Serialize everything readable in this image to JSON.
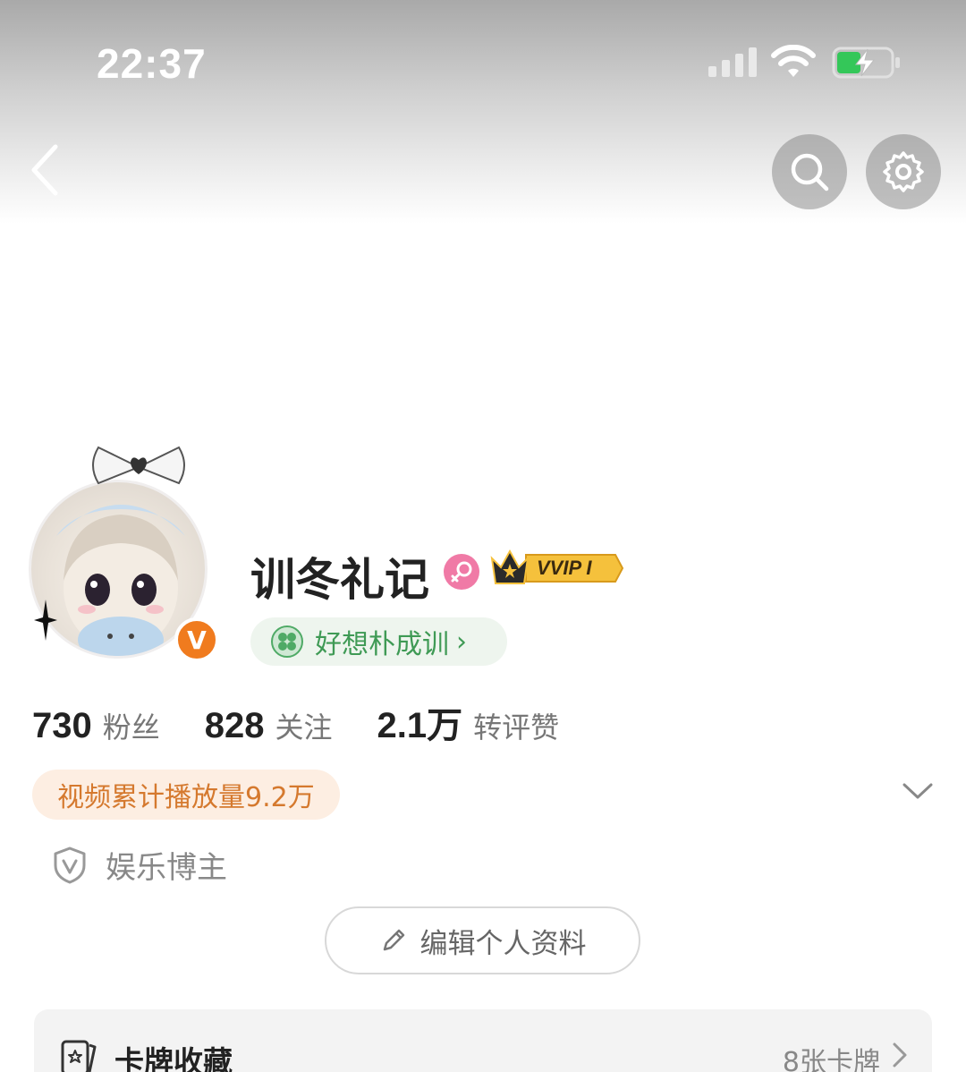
{
  "status_bar": {
    "time": "22:37",
    "icons": [
      "signal-icon",
      "wifi-icon",
      "battery-charging-icon"
    ],
    "battery_color": "#34c759"
  },
  "nav": {
    "icons": [
      "back-icon",
      "search-icon",
      "gear-icon"
    ]
  },
  "profile": {
    "username": "训冬礼记",
    "gender_icon": "female-icon",
    "gender_color": "#f07aa6",
    "vip_label": "VVIP I",
    "verified_mark": "V",
    "verified_color": "#f07b1e",
    "tag": {
      "label": "好想朴成训",
      "chevron": "›"
    }
  },
  "stats": [
    {
      "value": "730",
      "label": "粉丝"
    },
    {
      "value": "828",
      "label": "关注"
    },
    {
      "value": "2.1万",
      "label": "转评赞"
    }
  ],
  "play_count": "视频累计播放量9.2万",
  "role": {
    "label": "娱乐博主"
  },
  "edit_button": {
    "label": "编辑个人资料"
  },
  "card_collection": {
    "title": "卡牌收藏",
    "count": "8张卡牌"
  }
}
